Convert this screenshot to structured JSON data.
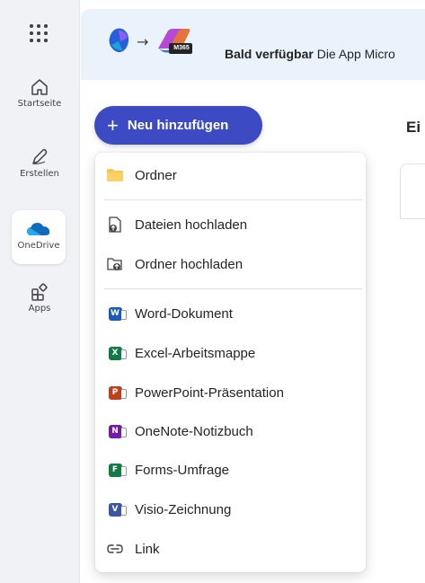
{
  "rail": {
    "items": [
      {
        "label": "Startseite",
        "icon": "home-icon"
      },
      {
        "label": "Erstellen",
        "icon": "pen-icon"
      },
      {
        "label": "OneDrive",
        "icon": "onedrive-cloud-icon"
      },
      {
        "label": "Apps",
        "icon": "apps-icon"
      }
    ]
  },
  "banner": {
    "bold": "Bald verfügbar",
    "text": " Die App Micro",
    "badge": "M365"
  },
  "page_title": "Ei",
  "new_button": {
    "label": "Neu hinzufügen"
  },
  "menu": {
    "items": [
      {
        "label": "Ordner",
        "icon": "folder-icon"
      },
      {
        "label": "Dateien hochladen",
        "icon": "file-upload-icon"
      },
      {
        "label": "Ordner hochladen",
        "icon": "folder-upload-icon"
      },
      {
        "label": "Word-Dokument",
        "icon": "word-icon",
        "letter": "W",
        "color": "#185abd"
      },
      {
        "label": "Excel-Arbeitsmappe",
        "icon": "excel-icon",
        "letter": "X",
        "color": "#107c41"
      },
      {
        "label": "PowerPoint-Präsentation",
        "icon": "powerpoint-icon",
        "letter": "P",
        "color": "#c43e1c"
      },
      {
        "label": "OneNote-Notizbuch",
        "icon": "onenote-icon",
        "letter": "N",
        "color": "#7719aa"
      },
      {
        "label": "Forms-Umfrage",
        "icon": "forms-icon",
        "letter": "F",
        "color": "#107c41"
      },
      {
        "label": "Visio-Zeichnung",
        "icon": "visio-icon",
        "letter": "V",
        "color": "#3955a3"
      },
      {
        "label": "Link",
        "icon": "link-icon"
      }
    ]
  },
  "colors": {
    "accent": "#3c4bc4",
    "banner": "#eaf3fb",
    "onedrive_active": "#107c41"
  }
}
